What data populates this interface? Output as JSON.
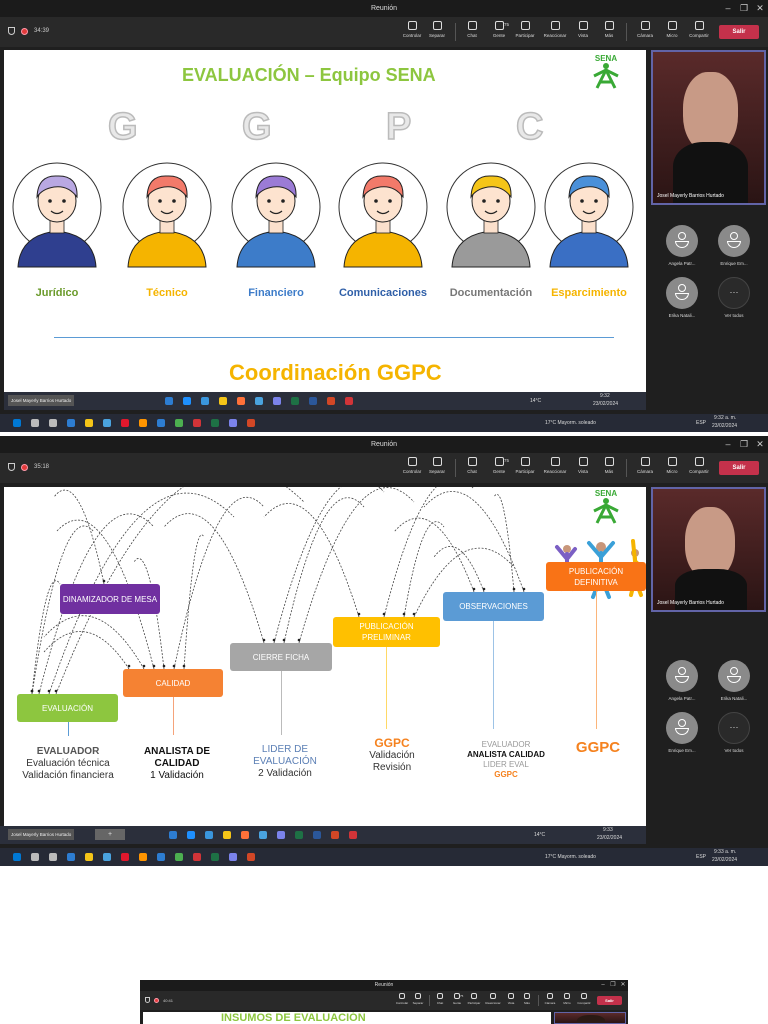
{
  "window_title": "Reunión",
  "toolbar": {
    "buttons": [
      "Controlar",
      "Separar",
      "Chat",
      "Gente",
      "Participar",
      "Reaccionar",
      "Vista",
      "Más",
      "Cámara",
      "Micro",
      "Compartir"
    ],
    "people_count": "75",
    "leave": "Salir"
  },
  "presenter": "Josel Mayerly Barrios Hurtado",
  "panel1": {
    "timer": "34:39",
    "participants": [
      "Angela Patr...",
      "Enrique Em...",
      "Erika Natali...",
      "Ver todos"
    ],
    "slide": {
      "title": "EVALUACIÓN – Equipo SENA",
      "logo": "SENA",
      "letters": [
        "G",
        "G",
        "P",
        "C"
      ],
      "roles": [
        {
          "label": "Jurídico",
          "color": "#6a9a2a",
          "hair": "#b9a8e2",
          "body": "#2f3f8f"
        },
        {
          "label": "Técnico",
          "color": "#f5b400",
          "hair": "#f27a6a",
          "body": "#f5b400"
        },
        {
          "label": "Financiero",
          "color": "#3d7cc9",
          "hair": "#9b7bd6",
          "body": "#3d7cc9"
        },
        {
          "label": "Comunicaciones",
          "color": "#2f5fa8",
          "hair": "#f27a6a",
          "body": "#f5b400"
        },
        {
          "label": "Documentación",
          "color": "#777777",
          "hair": "#f5c518",
          "body": "#9a9a9a"
        },
        {
          "label": "Esparcimiento",
          "color": "#f5b400",
          "hair": "#4a90d9",
          "body": "#3a6fc4"
        }
      ],
      "footer": "Coordinación GGPC"
    },
    "inner_taskbar": {
      "weather": "14°C",
      "time": "9:32",
      "date": "23/02/2024"
    },
    "outer_taskbar": {
      "weather": "17°C  Mayorm. soleado",
      "lang": "ESP",
      "time": "9:32 a. m.",
      "date": "23/02/2024"
    }
  },
  "panel2": {
    "timer": "35:18",
    "participants": [
      "Angela Patr...",
      "Erika Natali...",
      "Enrique Em...",
      "Ver todos"
    ],
    "slide": {
      "logo": "SENA",
      "boxes": [
        "DINAMIZADOR DE MESA",
        "CALIDAD",
        "CIERRE FICHA",
        "PUBLICACIÓN PRELIMINAR",
        "OBSERVACIONES",
        "PUBLICACIÓN DEFINITIVA",
        "EVALUACIÓN"
      ],
      "columns": [
        [
          "EVALUADOR",
          "Evaluación técnica",
          "Validación financiera"
        ],
        [
          "ANALISTA DE",
          "CALIDAD",
          "1 Validación"
        ],
        [
          "LIDER DE",
          "EVALUACIÓN",
          "2 Validación"
        ],
        [
          "GGPC",
          "Validación",
          "Revisión"
        ],
        [
          "EVALUADOR",
          "ANALISTA CALIDAD",
          "LIDER EVAL",
          "GGPC"
        ],
        [
          "GGPC"
        ]
      ]
    },
    "inner_taskbar": {
      "weather": "14°C",
      "time": "9:33",
      "date": "23/02/2024"
    },
    "outer_taskbar": {
      "weather": "17°C  Mayorm. soleado",
      "lang": "ESP",
      "time": "9:33 a. m.",
      "date": "23/02/2024"
    }
  },
  "panel3": {
    "timer": "40:41",
    "slide_title": "INSUMOS DE EVALUACIÓN"
  }
}
